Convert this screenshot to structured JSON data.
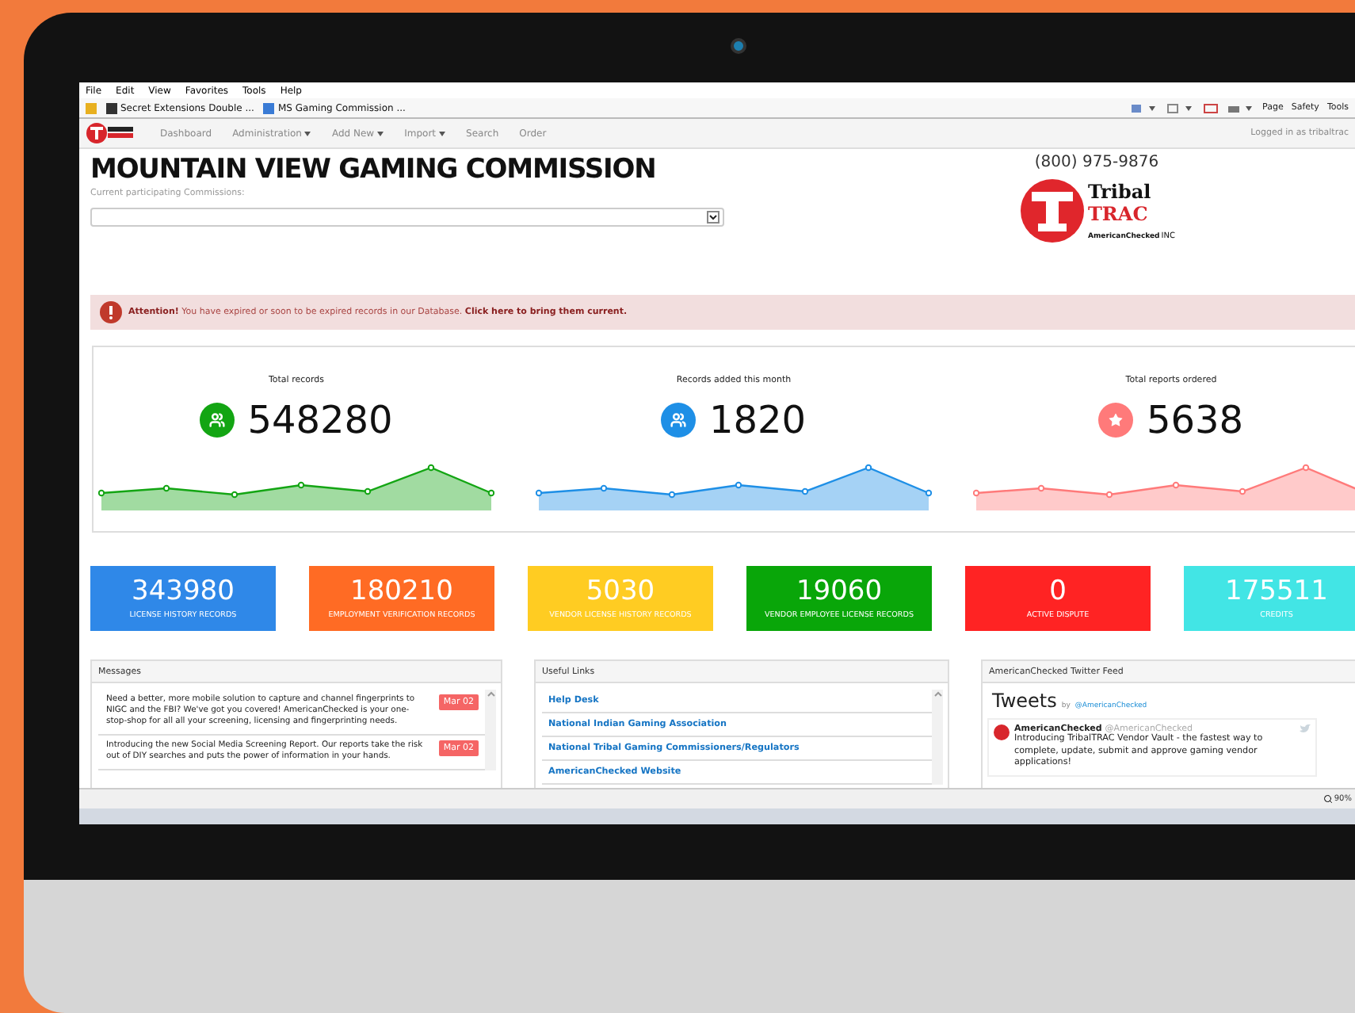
{
  "browser": {
    "menu": [
      "File",
      "Edit",
      "View",
      "Favorites",
      "Tools",
      "Help"
    ],
    "favorites": [
      {
        "label": "Secret Extensions Double ..."
      },
      {
        "label": "MS Gaming Commission ..."
      }
    ],
    "toolbar": [
      "Page",
      "Safety",
      "Tools"
    ],
    "zoom": "90%"
  },
  "nav": {
    "items": [
      {
        "label": "Dashboard",
        "dropdown": false
      },
      {
        "label": "Administration",
        "dropdown": true
      },
      {
        "label": "Add New",
        "dropdown": true
      },
      {
        "label": "Import",
        "dropdown": true
      },
      {
        "label": "Search",
        "dropdown": false
      },
      {
        "label": "Order",
        "dropdown": false
      }
    ],
    "user": "Logged in as tribaltrac"
  },
  "header": {
    "title": "MOUNTAIN VIEW GAMING COMMISSION",
    "select_label": "Current participating Commissions:",
    "phone": "(800) 975-9876",
    "logo": {
      "line_1": "Tribal",
      "line_2": "TRAC",
      "tagline": "AmericanChecked",
      "suffix": "INC"
    }
  },
  "alert": {
    "text": "**Attention!** You have expired or soon to be expired records in our Database. **Click here to bring them current.**"
  },
  "stats": [
    {
      "label": "Total records",
      "value": "548280",
      "kind": "people",
      "color": "#13a513"
    },
    {
      "label": "Records added this month",
      "value": "1820",
      "kind": "people",
      "color": "#1e8fe6"
    },
    {
      "label": "Total reports ordered",
      "value": "5638",
      "kind": "star",
      "color": "#ff7a7a"
    }
  ],
  "cards": [
    {
      "value": "343980",
      "label": "LICENSE HISTORY RECORDS",
      "color": "#2f88e8"
    },
    {
      "value": "180210",
      "label": "EMPLOYMENT VERIFICATION RECORDS",
      "color": "#ff6b24"
    },
    {
      "value": "5030",
      "label": "VENDOR LICENSE HISTORY RECORDS",
      "color": "#ffcc22"
    },
    {
      "value": "19060",
      "label": "VENDOR EMPLOYEE LICENSE RECORDS",
      "color": "#09a609"
    },
    {
      "value": "0",
      "label": "ACTIVE DISPUTE",
      "color": "#ff2323"
    },
    {
      "value": "175511",
      "label": "CREDITS",
      "color": "#42e5e5"
    }
  ],
  "messages": {
    "title": "Messages",
    "items": [
      {
        "text": "Need a better, more mobile solution to capture and channel fingerprints to NIGC and the FBI? We've got you covered! AmericanChecked is your one-stop-shop for all all your screening, licensing and fingerprinting needs.",
        "date": "Mar 02"
      },
      {
        "text": "Introducing the new Social Media Screening Report. Our reports take the risk out of DIY searches and puts the power of information in your hands.",
        "date": "Mar 02"
      }
    ]
  },
  "links": {
    "title": "Useful Links",
    "items": [
      "Help Desk",
      "National Indian Gaming Association",
      "National Tribal Gaming Commissioners/Regulators",
      "AmericanChecked Website"
    ]
  },
  "twitter": {
    "title": "AmericanChecked Twitter Feed",
    "heading": "Tweets",
    "by": "by",
    "handle": "@AmericanChecked",
    "tweet": {
      "name": "AmericanChecked",
      "handle": "@AmericanChecked",
      "text": "Introducing TribalTRAC Vendor Vault - the fastest way to complete, update, submit and approve gaming vendor applications!"
    }
  }
}
